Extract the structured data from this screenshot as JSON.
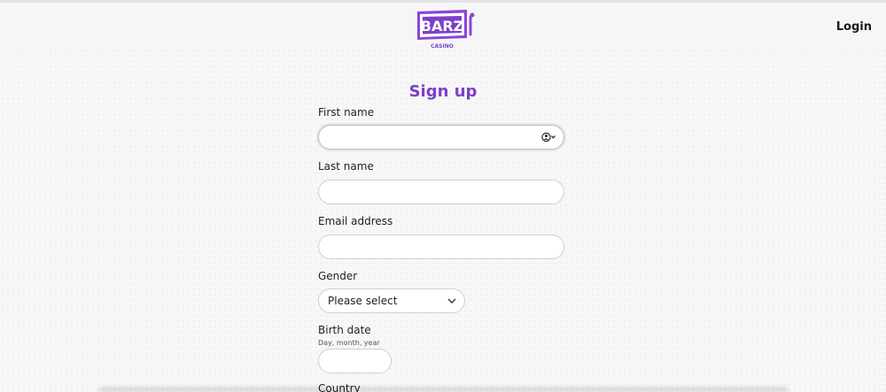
{
  "header": {
    "logo_text": "BARZ",
    "logo_subtext": "CASINO",
    "login_label": "Login"
  },
  "form": {
    "title": "Sign up",
    "fields": {
      "first_name": {
        "label": "First name",
        "value": ""
      },
      "last_name": {
        "label": "Last name",
        "value": ""
      },
      "email": {
        "label": "Email address",
        "value": ""
      },
      "gender": {
        "label": "Gender",
        "selected": "Please select"
      },
      "birth_date": {
        "label": "Birth date",
        "hint": "Day, month, year",
        "value": ""
      },
      "country": {
        "label": "Country"
      }
    }
  },
  "icons": {
    "autofill": "contact-autofill-icon",
    "chevron": "chevron-down-icon"
  },
  "colors": {
    "brand_purple": "#7c3fc8",
    "background": "#f7f7f7"
  }
}
